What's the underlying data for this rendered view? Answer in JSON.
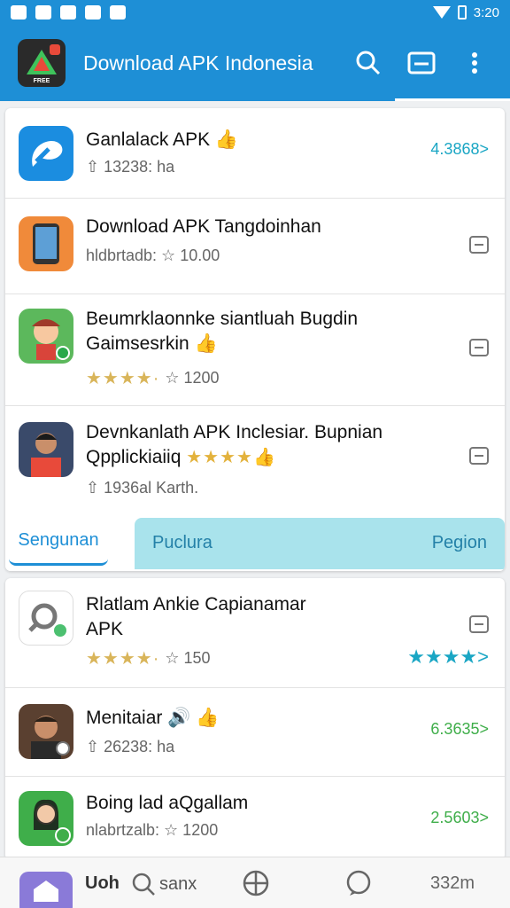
{
  "status_bar": {
    "time": "3:20"
  },
  "app_bar": {
    "logo_text": "FREE",
    "title": "Download APK Indonesia",
    "actions": [
      "search-icon",
      "window-icon",
      "more-vert-icon"
    ]
  },
  "list1": [
    {
      "title": "Ganlalack APK 👍",
      "meta": "⇧ 13238: ha",
      "right_text": "4.3868>",
      "right_color": "#1aa6c4"
    },
    {
      "title": "Download APK Tangdoinhan",
      "meta": "hldbrtadb: ☆ 10.00",
      "right_text": ""
    },
    {
      "title": "Beumrklaonnke siantluah Bugdin",
      "title2": "Gaimsesrkin 👍",
      "meta": "☆ 1200",
      "stars": "★★★★·",
      "right_text": ""
    },
    {
      "title": "Devnkanlath APK Inclesiar. Bupnian",
      "title2": "Qpplickiaiiq",
      "title2_stars": "★★★★👍",
      "meta": "⇧ 1936al Karth.",
      "right_text": ""
    }
  ],
  "tabs": {
    "tab_a": "Sengunan",
    "tab_b_left": "Puclura",
    "tab_b_right": "Pegion"
  },
  "list2": [
    {
      "title": "Rlatlam Ankie Capianamar",
      "title2": "APK",
      "meta": "☆ 150",
      "stars": "★★★★·",
      "right_stars": "★★★★>",
      "right_color": "#1aa6c4"
    },
    {
      "title": "Menitaiar 🔊 👍",
      "meta": "⇧ 26238: ha",
      "right_text": "6.3635>",
      "right_color": "#3fae4a"
    },
    {
      "title": "Boing lad aQgallam",
      "meta": "nlabrtzalb: ☆ 1200",
      "right_text": "2.5603>",
      "right_color": "#3fae4a"
    }
  ],
  "bottom_nav": {
    "item1": "Uoh",
    "item2": "sanx",
    "item5": "332m"
  }
}
